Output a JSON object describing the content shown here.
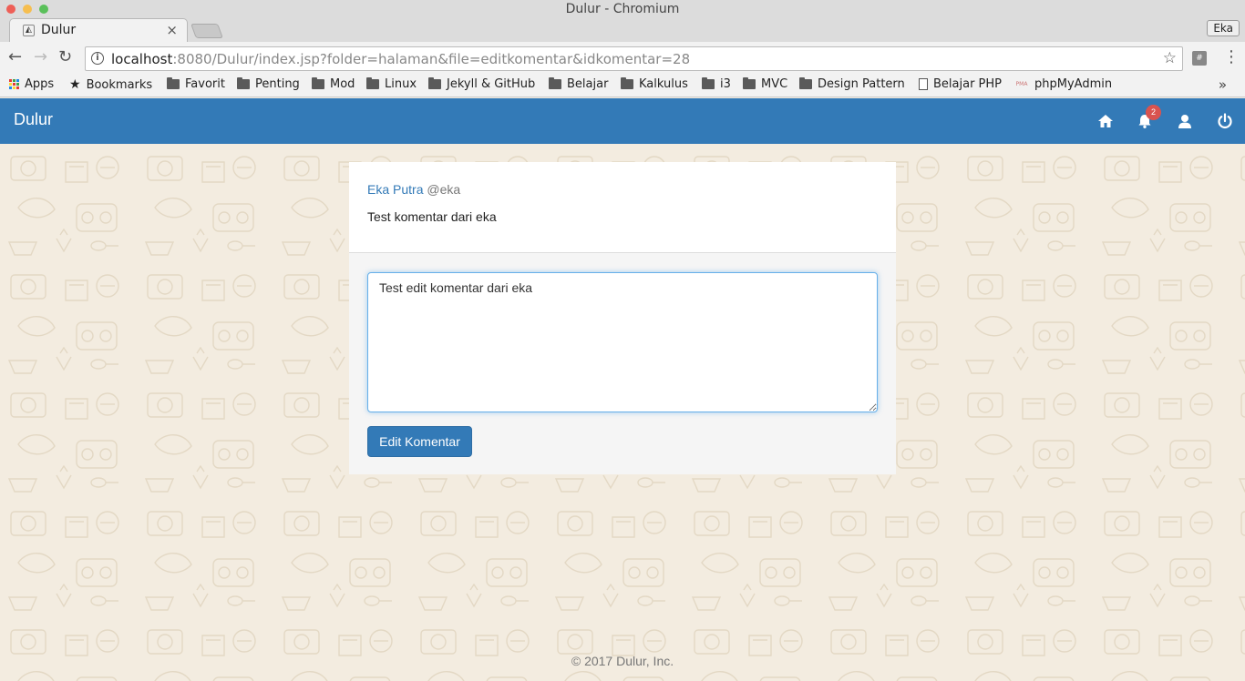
{
  "window": {
    "title": "Dulur - Chromium"
  },
  "tab": {
    "title": "Dulur",
    "close": "×"
  },
  "profile": {
    "label": "Eka"
  },
  "address": {
    "host": "localhost",
    "rest": ":8080/Dulur/index.jsp?folder=halaman&file=editkomentar&idkomentar=28"
  },
  "bookmarks": {
    "apps": "Apps",
    "items": [
      "Bookmarks",
      "Favorit",
      "Penting",
      "Mod",
      "Linux",
      "Jekyll & GitHub",
      "Belajar",
      "Kalkulus",
      "i3",
      "MVC",
      "Design Pattern",
      "Belajar PHP",
      "phpMyAdmin"
    ],
    "more": "»"
  },
  "navbar": {
    "brand": "Dulur",
    "notification_count": "2",
    "color": "#337ab7"
  },
  "comment": {
    "author_name": "Eka Putra",
    "author_handle": "@eka",
    "text": "Test komentar dari eka"
  },
  "editor": {
    "value": "Test edit komentar dari eka",
    "button_label": "Edit Komentar"
  },
  "footer": {
    "text": "© 2017 Dulur, Inc."
  },
  "icons": [
    "home-icon",
    "bell-icon",
    "user-icon",
    "power-icon",
    "star-icon",
    "info-icon"
  ]
}
